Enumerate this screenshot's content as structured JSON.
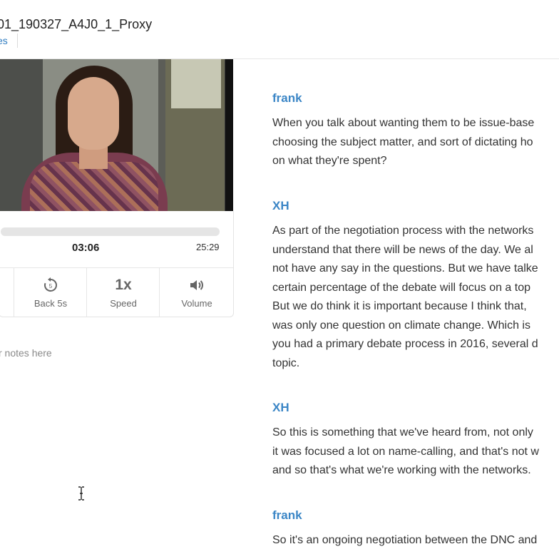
{
  "header": {
    "file_title": "01_190327_A4J0_1_Proxy",
    "files_link": "es"
  },
  "player": {
    "current_time": "03:06",
    "total_time": "25:29",
    "progress": 0.12,
    "controls": {
      "back_label": "Back 5s",
      "back_icon": "rewind-5-icon",
      "speed_value": "1x",
      "speed_label": "Speed",
      "volume_label": "Volume",
      "volume_icon": "speaker-icon"
    }
  },
  "notes": {
    "placeholder": "r notes here"
  },
  "transcript": {
    "blocks": [
      {
        "speaker": "frank",
        "lines": [
          "When you talk about wanting them to be issue-base",
          "choosing the subject matter, and sort of dictating ho",
          "on what they're spent?"
        ]
      },
      {
        "speaker": "XH",
        "lines": [
          "As part of the negotiation process with the networks",
          "understand that there will be news of the day. We al",
          "not have any say in the questions. But we have talke",
          "certain percentage of the debate will focus on a top",
          "But we do think it is important because I think that,",
          "was only one question on climate change. Which is",
          "you had a primary debate process in 2016, several d",
          "topic."
        ]
      },
      {
        "speaker": "XH",
        "lines": [
          "So this is something that we've heard from, not only",
          "it was focused a lot on name-calling, and that's not w",
          "and so that's what we're working with the networks."
        ]
      },
      {
        "speaker": "frank",
        "lines": [
          "So it's an ongoing negotiation between the DNC and"
        ]
      }
    ]
  }
}
